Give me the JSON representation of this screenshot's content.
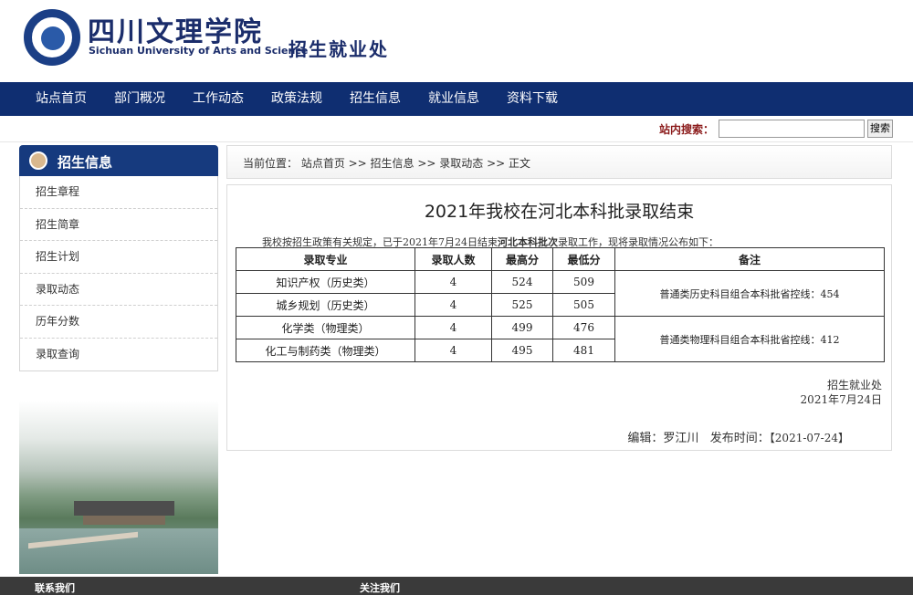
{
  "header": {
    "school_cn": "四川文理学院",
    "school_en": "Sichuan University of Arts and Science",
    "dept": "招生就业处"
  },
  "nav": {
    "items": [
      "站点首页",
      "部门概况",
      "工作动态",
      "政策法规",
      "招生信息",
      "就业信息",
      "资料下载"
    ]
  },
  "search": {
    "label": "站内搜索：",
    "value": "",
    "button": "搜索"
  },
  "sidebar": {
    "title": "招生信息",
    "items": [
      "招生章程",
      "招生简章",
      "招生计划",
      "录取动态",
      "历年分数",
      "录取查询"
    ]
  },
  "breadcrumb": "当前位置：  站点首页 >> 招生信息 >> 录取动态 >> 正文",
  "article": {
    "title": "2021年我校在河北本科批录取结束",
    "intro_before": "我校按招生政策有关规定，已于2021年7月24日结束",
    "intro_bold": "河北本科批次",
    "intro_after": "录取工作，现将录取情况公布如下：",
    "table": {
      "headers": [
        "录取专业",
        "录取人数",
        "最高分",
        "最低分",
        "备注"
      ],
      "rows": [
        {
          "major": "知识产权（历史类）",
          "count": "4",
          "high": "524",
          "low": "509"
        },
        {
          "major": "城乡规划（历史类）",
          "count": "4",
          "high": "525",
          "low": "505"
        },
        {
          "major": "化学类（物理类）",
          "count": "4",
          "high": "499",
          "low": "476"
        },
        {
          "major": "化工与制药类（物理类）",
          "count": "4",
          "high": "495",
          "low": "481"
        }
      ],
      "remarks": [
        "普通类历史科目组合本科批省控线：454",
        "普通类物理科目组合本科批省控线：412"
      ]
    },
    "sign_dept": "招生就业处",
    "sign_date": "2021年7月24日",
    "editor_label": "编辑：",
    "editor": "罗江川",
    "publish_label": "发布时间：",
    "publish_date": "【2021-07-24】"
  },
  "footer": {
    "contact": "联系我们",
    "follow": "关注我们"
  },
  "colors": {
    "nav_bg": "#0f2e71",
    "brand_text": "#1b2d6b",
    "sidebar_head": "#163a7e",
    "search_label": "#8b1a1a"
  }
}
